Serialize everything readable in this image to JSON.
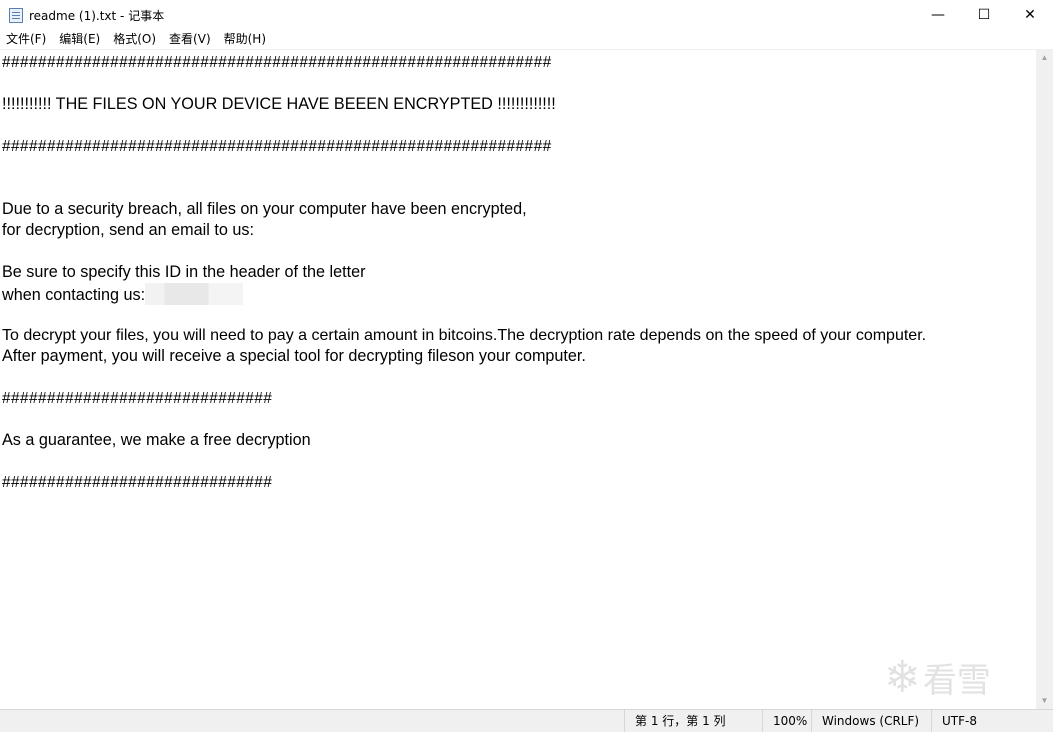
{
  "window": {
    "title": "readme (1).txt - 记事本",
    "icon": "notepad-icon",
    "buttons": {
      "minimize": "—",
      "maximize": "☐",
      "close": "✕"
    }
  },
  "menu": {
    "items": [
      "文件(F)",
      "编辑(E)",
      "格式(O)",
      "查看(V)",
      "帮助(H)"
    ]
  },
  "document": {
    "lines": [
      "#############################################################",
      "",
      "!!!!!!!!!!! THE FILES ON YOUR DEVICE HAVE BEEEN ENCRYPTED !!!!!!!!!!!!!",
      "",
      "#############################################################",
      "",
      "",
      "Due to a security breach, all files on your computer have been encrypted,",
      "for decryption, send an email to us:",
      "",
      "Be sure to specify this ID in the header of the letter",
      "when contacting us:",
      "",
      "To decrypt your files, you will need to pay a certain amount in bitcoins.The decryption rate depends on the speed of your computer.",
      "After payment, you will receive a special tool for decrypting fileson your computer.",
      "",
      "##############################",
      "",
      "As a guarantee, we make a free decryption",
      "",
      "##############################"
    ]
  },
  "statusbar": {
    "position": "第 1 行，第 1 列",
    "zoom": "100%",
    "line_ending": "Windows (CRLF)",
    "encoding": "UTF-8"
  },
  "watermark": {
    "text": "看雪",
    "icon": "snowflake-icon",
    "glyph": "❄"
  }
}
